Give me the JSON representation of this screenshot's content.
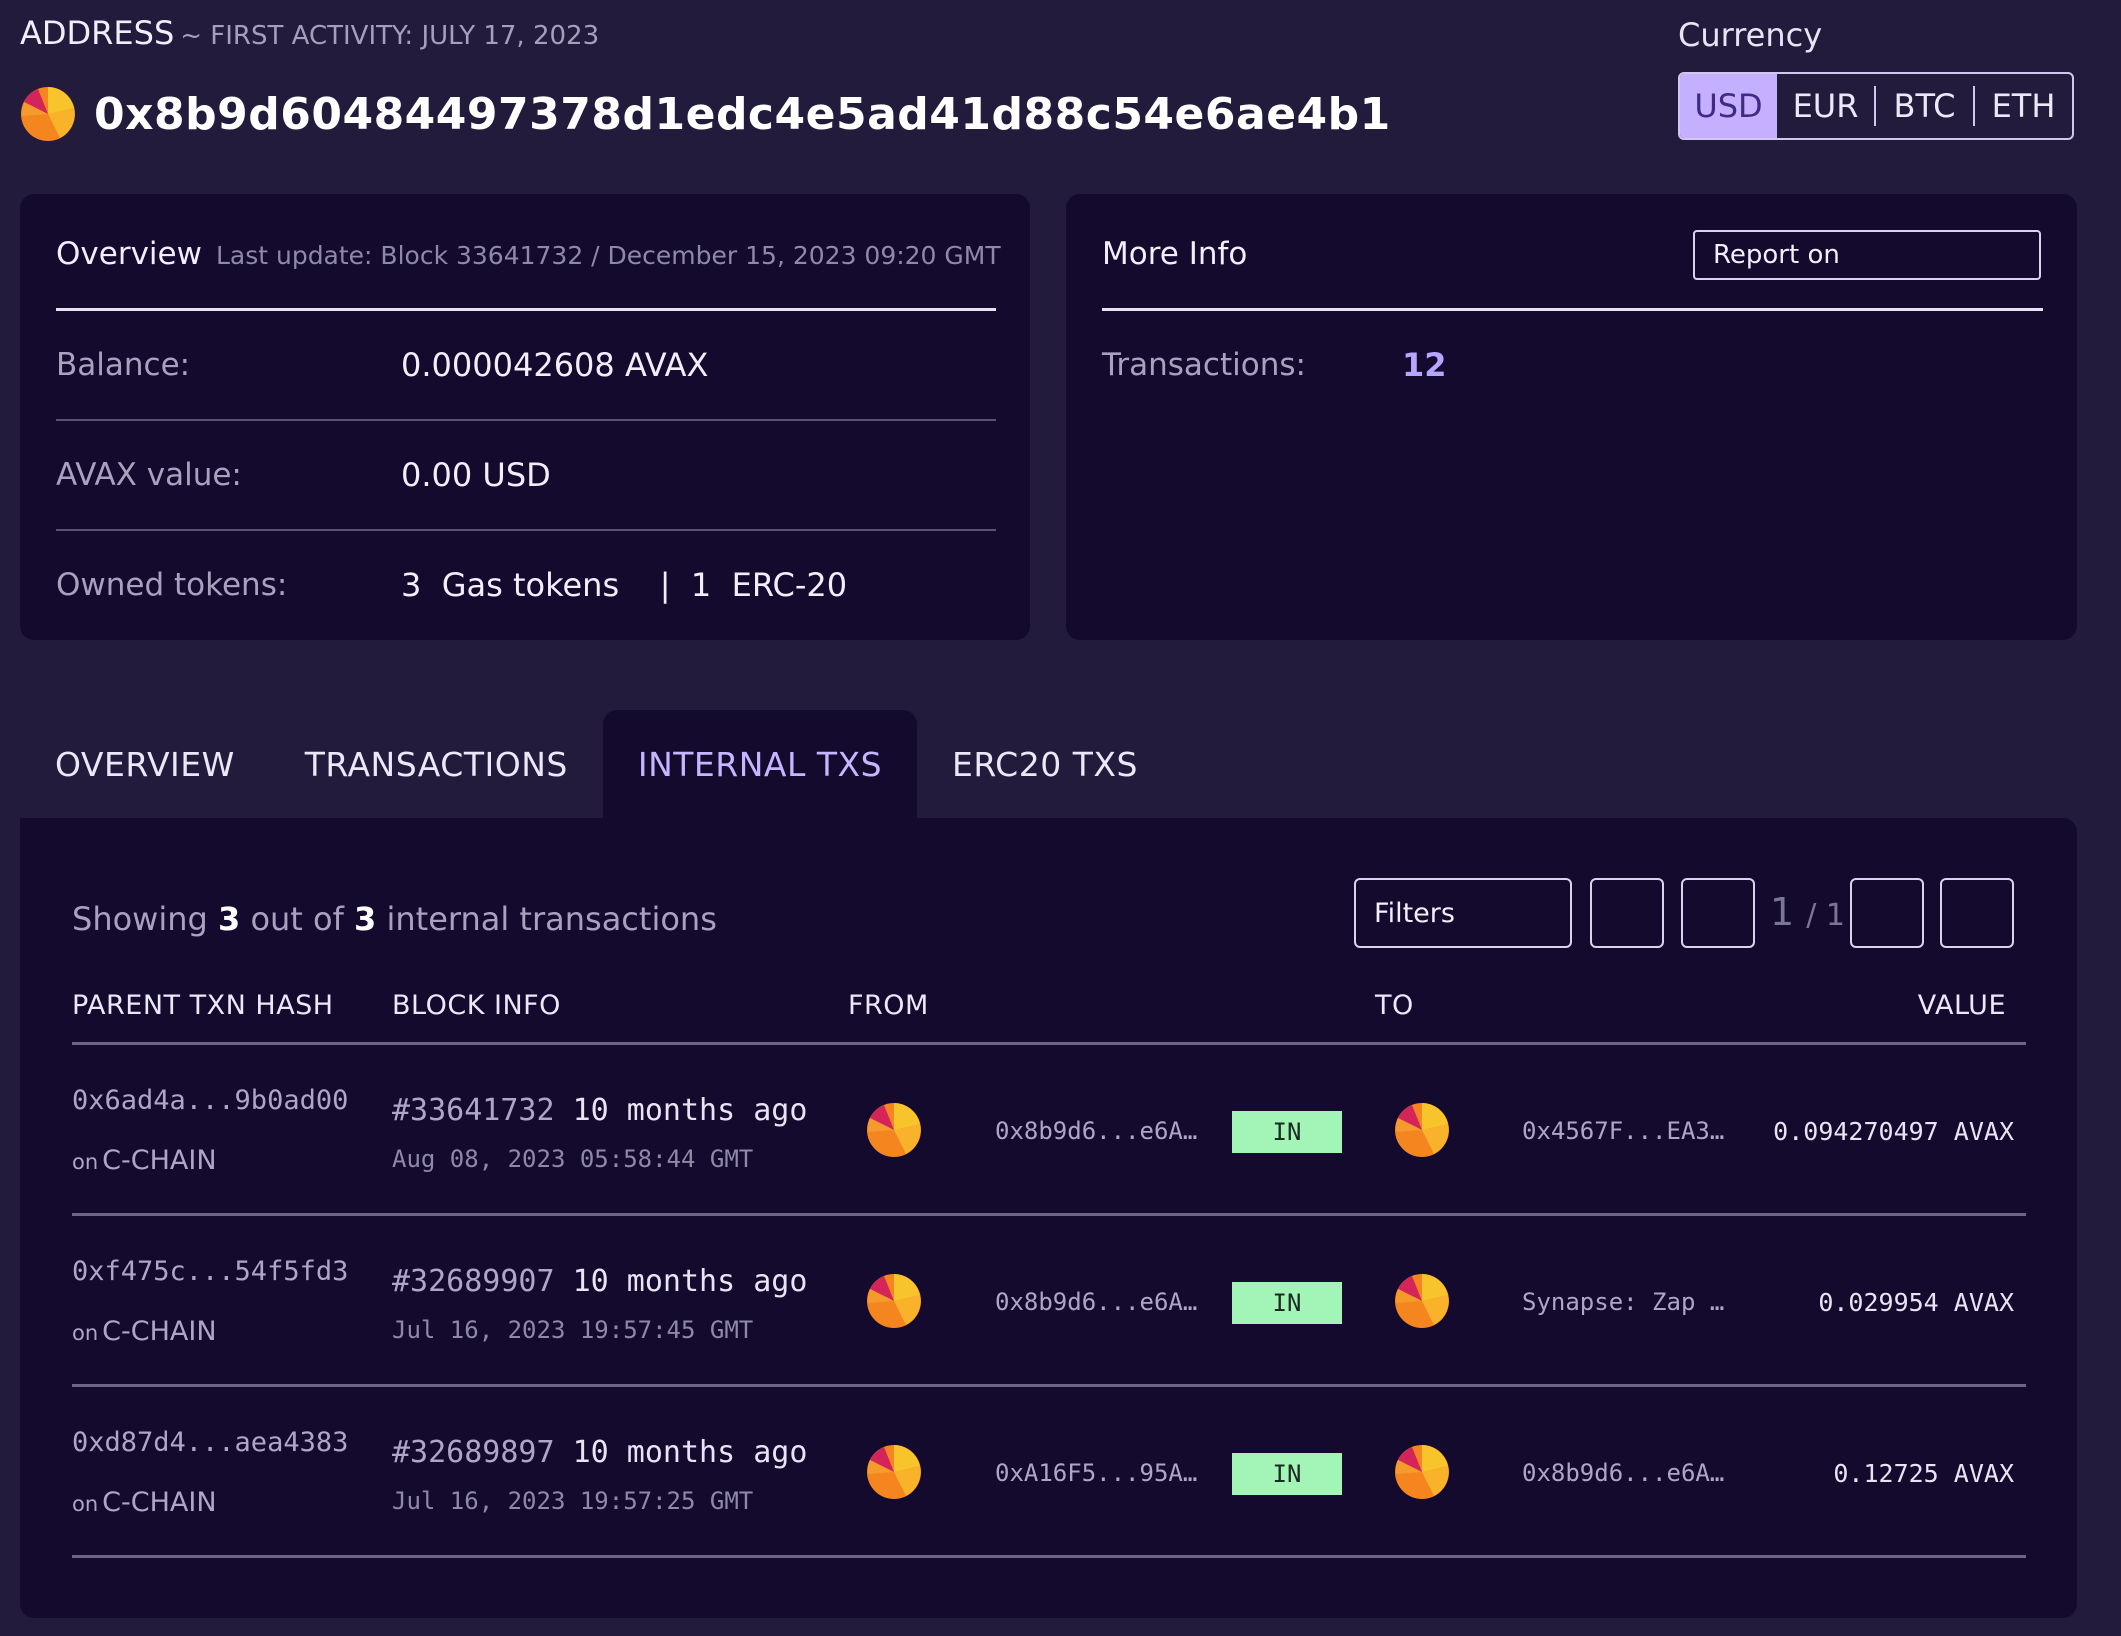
{
  "header": {
    "address_label": "ADDRESS",
    "first_activity": "~ FIRST ACTIVITY: JULY 17, 2023",
    "address": "0x8b9d60484497378d1edc4e5ad41d88c54e6ae4b1",
    "avatar_icon": "pie-avatar-icon"
  },
  "currency": {
    "title": "Currency",
    "options": [
      "USD",
      "EUR",
      "BTC",
      "ETH"
    ],
    "selected": "USD",
    "active_color": "#c4b0ff"
  },
  "overview_card": {
    "title": "Overview",
    "subtitle": "Last update: Block 33641732 / December 15, 2023 09:20 GMT",
    "balance_label": "Balance:",
    "balance_value": "0.000042608  AVAX",
    "avax_value_label": "AVAX value:",
    "avax_value": "0.00  USD",
    "owned_tokens_label": "Owned tokens:",
    "owned_tokens_value": "3  Gas tokens    |  1  ERC-20"
  },
  "more_info_card": {
    "title": "More Info",
    "report_button": "Report on",
    "transactions_label": "Transactions:",
    "transactions_value": "12"
  },
  "tabs": [
    {
      "label": "OVERVIEW",
      "active": false
    },
    {
      "label": "TRANSACTIONS",
      "active": false
    },
    {
      "label": "INTERNAL TXS",
      "active": true
    },
    {
      "label": "ERC20 TXS",
      "active": false
    }
  ],
  "table_summary": {
    "prefix": "Showing",
    "shown": "3",
    "middle": "out of",
    "total": "3",
    "suffix": "internal transactions"
  },
  "pagination": {
    "filters_label": "Filters",
    "current": "1",
    "separator_total": "/ 1"
  },
  "table": {
    "columns": [
      "PARENT TXN HASH",
      "BLOCK INFO",
      "FROM",
      "TO",
      "VALUE"
    ],
    "rows": [
      {
        "hash": "0x6ad4a...9b0ad00",
        "chain_prefix": "on",
        "chain": "C-CHAIN",
        "block": "#33641732",
        "age": "10 months ago",
        "date": "Aug 08, 2023 05:58:44 GMT",
        "from": "0x8b9d6...e6A…",
        "direction": "IN",
        "to": "0x4567F...EA3…",
        "value": "0.094270497 AVAX"
      },
      {
        "hash": "0xf475c...54f5fd3",
        "chain_prefix": "on",
        "chain": "C-CHAIN",
        "block": "#32689907",
        "age": "10 months ago",
        "date": "Jul 16, 2023 19:57:45 GMT",
        "from": "0x8b9d6...e6A…",
        "direction": "IN",
        "to": "Synapse: Zap …",
        "value": "0.029954 AVAX"
      },
      {
        "hash": "0xd87d4...aea4383",
        "chain_prefix": "on",
        "chain": "C-CHAIN",
        "block": "#32689897",
        "age": "10 months ago",
        "date": "Jul 16, 2023 19:57:25 GMT",
        "from": "0xA16F5...95A…",
        "direction": "IN",
        "to": "0x8b9d6...e6A…",
        "value": "0.12725 AVAX"
      }
    ]
  },
  "colors": {
    "background": "#231b3c",
    "card": "#130a2d",
    "accent": "#c4b0ff",
    "badge_in": "#a2f5b6",
    "avatar_orange": "#f5851f",
    "avatar_yellow": "#f8c42c",
    "avatar_red": "#d4245a"
  }
}
